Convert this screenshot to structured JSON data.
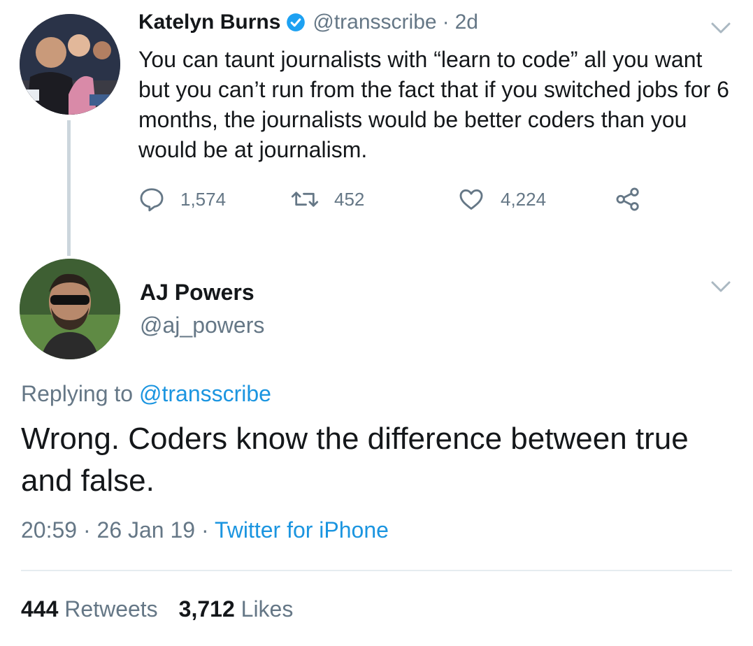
{
  "tweet1": {
    "name": "Katelyn Burns",
    "handle": "@transscribe",
    "separator": "·",
    "age": "2d",
    "text": "You can taunt journalists with “learn to code” all you want but you can’t run from the fact that if you switched jobs for 6 months, the journalists would be better coders than you would be at journalism.",
    "replies": "1,574",
    "retweets": "452",
    "likes": "4,224"
  },
  "tweet2": {
    "name": "AJ Powers",
    "handle": "@aj_powers",
    "replying_prefix": "Replying to",
    "replying_handle": "@transscribe",
    "text": "Wrong. Coders know the difference between true and false.",
    "time": "20:59",
    "sep1": "·",
    "date": "26 Jan 19",
    "sep2": "·",
    "source": "Twitter for iPhone",
    "retweet_count": "444",
    "retweet_label": "Retweets",
    "like_count": "3,712",
    "like_label": "Likes"
  },
  "colors": {
    "link": "#1b95e0",
    "muted": "#657786",
    "text": "#14171a",
    "verified": "#1da1f2"
  },
  "icons": [
    "reply-icon",
    "retweet-icon",
    "like-icon",
    "share-icon",
    "verified-icon",
    "chevron-down-icon"
  ]
}
